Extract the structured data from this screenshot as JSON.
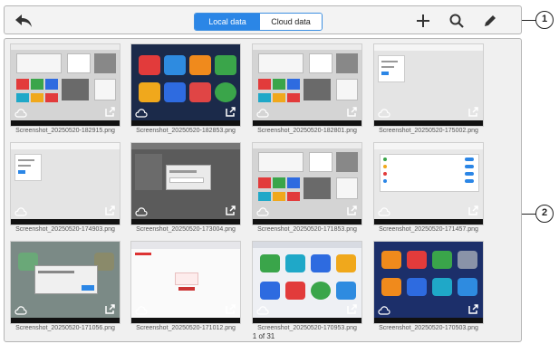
{
  "toolbar": {
    "back_icon": "back-arrow-icon",
    "tabs": [
      {
        "label": "Local data",
        "active": true
      },
      {
        "label": "Cloud data",
        "active": false
      }
    ],
    "actions": [
      "add-icon",
      "search-icon",
      "edit-icon"
    ]
  },
  "callouts": [
    "1",
    "2"
  ],
  "screenshots": [
    {
      "filename": "Screenshot_20250520-182915.png",
      "style": "mixed"
    },
    {
      "filename": "Screenshot_20250520-182853.png",
      "style": "dark-apps"
    },
    {
      "filename": "Screenshot_20250520-182801.png",
      "style": "mixed"
    },
    {
      "filename": "Screenshot_20250520-175002.png",
      "style": "light-dialog"
    },
    {
      "filename": "Screenshot_20250520-174903.png",
      "style": "light-dialog"
    },
    {
      "filename": "Screenshot_20250520-173004.png",
      "style": "dark-dialog"
    },
    {
      "filename": "Screenshot_20250520-171853.png",
      "style": "mixed"
    },
    {
      "filename": "Screenshot_20250520-171457.png",
      "style": "settings"
    },
    {
      "filename": "Screenshot_20250520-171056.png",
      "style": "gray-dialog"
    },
    {
      "filename": "Screenshot_20250520-171012.png",
      "style": "browser"
    },
    {
      "filename": "Screenshot_20250520-170953.png",
      "style": "color-apps"
    },
    {
      "filename": "Screenshot_20250520-170503.png",
      "style": "dark-apps2"
    }
  ],
  "pager": {
    "text": "1 of 31"
  },
  "colors": {
    "accent": "#2b86e6",
    "frame": "#b5b5b5"
  }
}
